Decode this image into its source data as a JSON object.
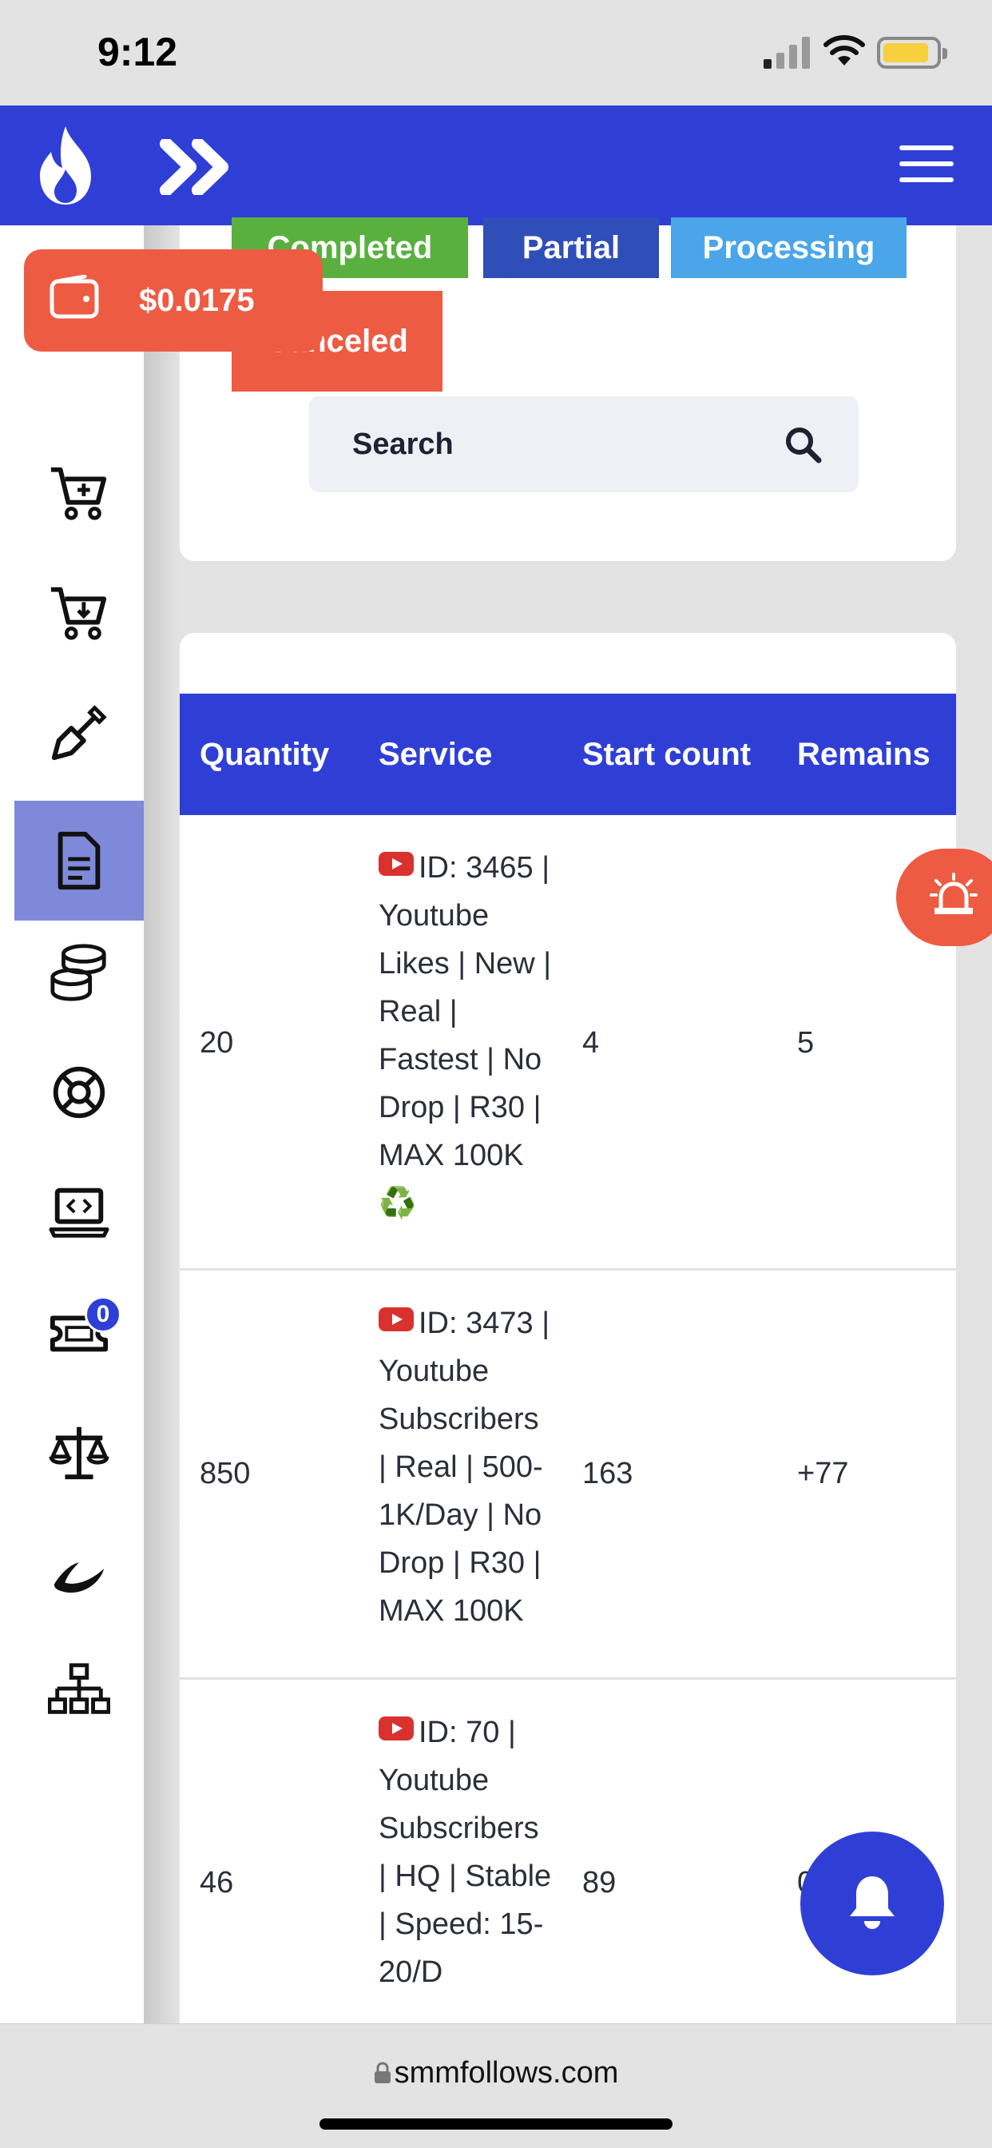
{
  "status": {
    "time": "9:12"
  },
  "header": {
    "menu_icon": "hamburger-menu-icon",
    "logo_icon": "flame-icon",
    "nav_icon": "double-chevron-right-icon"
  },
  "balance": {
    "amount": "$0.0175"
  },
  "filters": {
    "chips": [
      {
        "label": "Completed",
        "color": "#59b03f"
      },
      {
        "label": "Partial",
        "color": "#2f4eb8"
      },
      {
        "label": "Processing",
        "color": "#4aa6e8"
      },
      {
        "label": "Canceled",
        "visible_text": "nceled",
        "color": "#ee5b43"
      }
    ],
    "search_placeholder": "Search"
  },
  "sidebar": {
    "items": [
      {
        "icon": "cart-plus-icon"
      },
      {
        "icon": "cart-download-icon"
      },
      {
        "icon": "shovel-icon"
      },
      {
        "icon": "document-icon",
        "active": true
      },
      {
        "icon": "coins-icon"
      },
      {
        "icon": "lifebuoy-icon"
      },
      {
        "icon": "laptop-code-icon"
      },
      {
        "icon": "ticket-icon",
        "badge": "0"
      },
      {
        "icon": "scale-icon"
      },
      {
        "icon": "brush-stroke-icon"
      },
      {
        "icon": "sitemap-icon"
      }
    ]
  },
  "table": {
    "headers": [
      "Quantity",
      "Service",
      "Start count",
      "Remains"
    ],
    "rows": [
      {
        "quantity": "20",
        "service": "ID: 3465 | Youtube Likes | New | Real | Fastest | No Drop | R30 | MAX 100K ♻️",
        "start_count": "4",
        "remains": "5"
      },
      {
        "quantity": "850",
        "service": "ID: 3473 | Youtube Subscribers | Real | 500-1K/Day | No Drop | R30 | MAX 100K",
        "start_count": "163",
        "remains": "+77"
      },
      {
        "quantity": "46",
        "service": "ID: 70 | Youtube Subscribers | HQ | Stable | Speed: 15-20/D",
        "start_count": "89",
        "remains": "0"
      }
    ]
  },
  "browser": {
    "url": "smmfollows.com"
  },
  "colors": {
    "primary": "#2f3fd6",
    "accent": "#ee5b43",
    "active_item": "#7f89d9"
  }
}
